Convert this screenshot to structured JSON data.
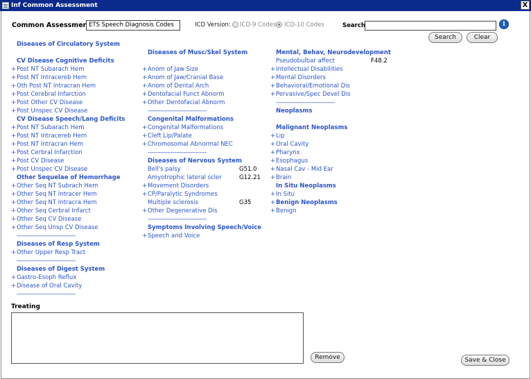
{
  "window": {
    "title": "Inf Common Assessment",
    "close_label": "X"
  },
  "header": {
    "common_label": "Common Assessments:",
    "common_value": "ETS Speech Diagnosis Codes",
    "icd_label": "ICD Version:",
    "icd9_label": "ICD-9 Codes",
    "icd10_label": "ICD-10 Codes",
    "search_label": "Search:",
    "search_value": "",
    "search_button": "Search",
    "clear_button": "Clear"
  },
  "columns": [
    {
      "items": [
        {
          "type": "head",
          "text": "Diseases of Circulatory System"
        },
        {
          "type": "gap"
        },
        {
          "type": "head",
          "text": "CV Disease Cognitive Deficits"
        },
        {
          "type": "link",
          "text": "Post NT Subarach Hem"
        },
        {
          "type": "link",
          "text": "Post NT Intracereb Hem"
        },
        {
          "type": "link",
          "text": "Oth Post NT Intracran Hem"
        },
        {
          "type": "link",
          "text": "Post Cerebral Infarction"
        },
        {
          "type": "link",
          "text": "Post Other CV Disease"
        },
        {
          "type": "link",
          "text": "Post Unspec CV Disease"
        },
        {
          "type": "head",
          "text": "CV Disease Speech/Lang Deficits"
        },
        {
          "type": "link",
          "text": "Post NT Subarach Hem"
        },
        {
          "type": "link",
          "text": "Post NT Intracereb Hem"
        },
        {
          "type": "link",
          "text": "Post NT Intracran Hem"
        },
        {
          "type": "link",
          "text": "Post Cerbral Infarction"
        },
        {
          "type": "link",
          "text": "Post CV Disease"
        },
        {
          "type": "link",
          "text": "Post Unspec CV Disease"
        },
        {
          "type": "head",
          "text": "Other Sequelae of Hemorrhage"
        },
        {
          "type": "link",
          "text": "Other Seq NT Subrach Hem"
        },
        {
          "type": "link",
          "text": "Other Seq NT Intracer Hem"
        },
        {
          "type": "link",
          "text": "Other Seq NT Intracra Hem"
        },
        {
          "type": "link",
          "text": "Other Seq Cerbral Infarct"
        },
        {
          "type": "link",
          "text": "Other Seq CV Disease"
        },
        {
          "type": "link",
          "text": "Other Seq Unsp CV Disease"
        },
        {
          "type": "sep",
          "text": "---------------------------------"
        },
        {
          "type": "head",
          "text": "Diseases of Resp System"
        },
        {
          "type": "link",
          "text": "Other Upper Resp Tract"
        },
        {
          "type": "sep",
          "text": "---------------------------------"
        },
        {
          "type": "head",
          "text": "Diseases of Digest System"
        },
        {
          "type": "link",
          "text": "Gastro-Esoph Reflux"
        },
        {
          "type": "link",
          "text": "Disease of Oral Cavity"
        },
        {
          "type": "sep",
          "text": "---------------------------------"
        }
      ]
    },
    {
      "items": [
        {
          "type": "gap"
        },
        {
          "type": "head",
          "text": "Diseases of Musc/Skel System"
        },
        {
          "type": "gap"
        },
        {
          "type": "link",
          "text": "Anom of Jaw Size"
        },
        {
          "type": "link",
          "text": "Anom of Jaw/Cranial Base"
        },
        {
          "type": "link",
          "text": "Anom of Dental Arch"
        },
        {
          "type": "link",
          "text": "Dentofacial Funct Abnorm"
        },
        {
          "type": "link",
          "text": "Other Dentofacial Abnorm"
        },
        {
          "type": "sep",
          "text": "---------------------------------"
        },
        {
          "type": "head",
          "text": "Congenital Malformations"
        },
        {
          "type": "link",
          "text": "Congenital Malformations"
        },
        {
          "type": "link",
          "text": "Cleft Lip/Palate"
        },
        {
          "type": "link",
          "text": "Chromosomal Abnormal NEC"
        },
        {
          "type": "sep",
          "text": "---------------------------------"
        },
        {
          "type": "head",
          "text": "Diseases of Nervous System"
        },
        {
          "type": "plain",
          "text": "Bell's palsy",
          "code": "G51.0"
        },
        {
          "type": "plain",
          "text": "Amyotrophic lateral scler",
          "code": "G12.21"
        },
        {
          "type": "link",
          "text": "Movement Disorders"
        },
        {
          "type": "link",
          "text": "CP/Paralytic Syndromes"
        },
        {
          "type": "plain",
          "text": "Multiple sclerosis",
          "code": "G35"
        },
        {
          "type": "link",
          "text": "Other Degenerative Dis"
        },
        {
          "type": "sep",
          "text": "---------------------------------"
        },
        {
          "type": "head",
          "text": "Symptoms Involving Speech/Voice"
        },
        {
          "type": "link",
          "text": "Speech and Voice"
        }
      ]
    },
    {
      "items": [
        {
          "type": "gap"
        },
        {
          "type": "head",
          "text": "Mental, Behav, Neurodevelopment"
        },
        {
          "type": "plain",
          "text": "Pseudobulbar affect",
          "code": "F48.2"
        },
        {
          "type": "link",
          "text": "Intellectual Disabilities"
        },
        {
          "type": "link",
          "text": "Mental Disorders"
        },
        {
          "type": "link",
          "text": "Behavioral/Emotional Dis"
        },
        {
          "type": "link",
          "text": "Pervasive/Spec Devel Dis"
        },
        {
          "type": "sep",
          "text": "---------------------------------"
        },
        {
          "type": "head",
          "text": "Neoplasms"
        },
        {
          "type": "gap"
        },
        {
          "type": "head",
          "text": "Malignant Neoplasms"
        },
        {
          "type": "link",
          "text": "Lip"
        },
        {
          "type": "link",
          "text": "Oral Cavity"
        },
        {
          "type": "link",
          "text": "Pharynx"
        },
        {
          "type": "link",
          "text": "Esophagus"
        },
        {
          "type": "link",
          "text": "Nasal Cav - Mid Ear"
        },
        {
          "type": "link",
          "text": "Brain"
        },
        {
          "type": "head",
          "text": "In Situ Neoplasms"
        },
        {
          "type": "link",
          "text": "In Situ"
        },
        {
          "type": "linkhead",
          "text": "Benign Neoplasms"
        },
        {
          "type": "link",
          "text": "Benign"
        }
      ]
    }
  ],
  "footer": {
    "treating_label": "Treating",
    "treating_value": "",
    "remove_button": "Remove",
    "save_close_button": "Save & Close"
  },
  "colors": {
    "titlebar": "#0a2a8c",
    "link": "#2b55c8"
  }
}
